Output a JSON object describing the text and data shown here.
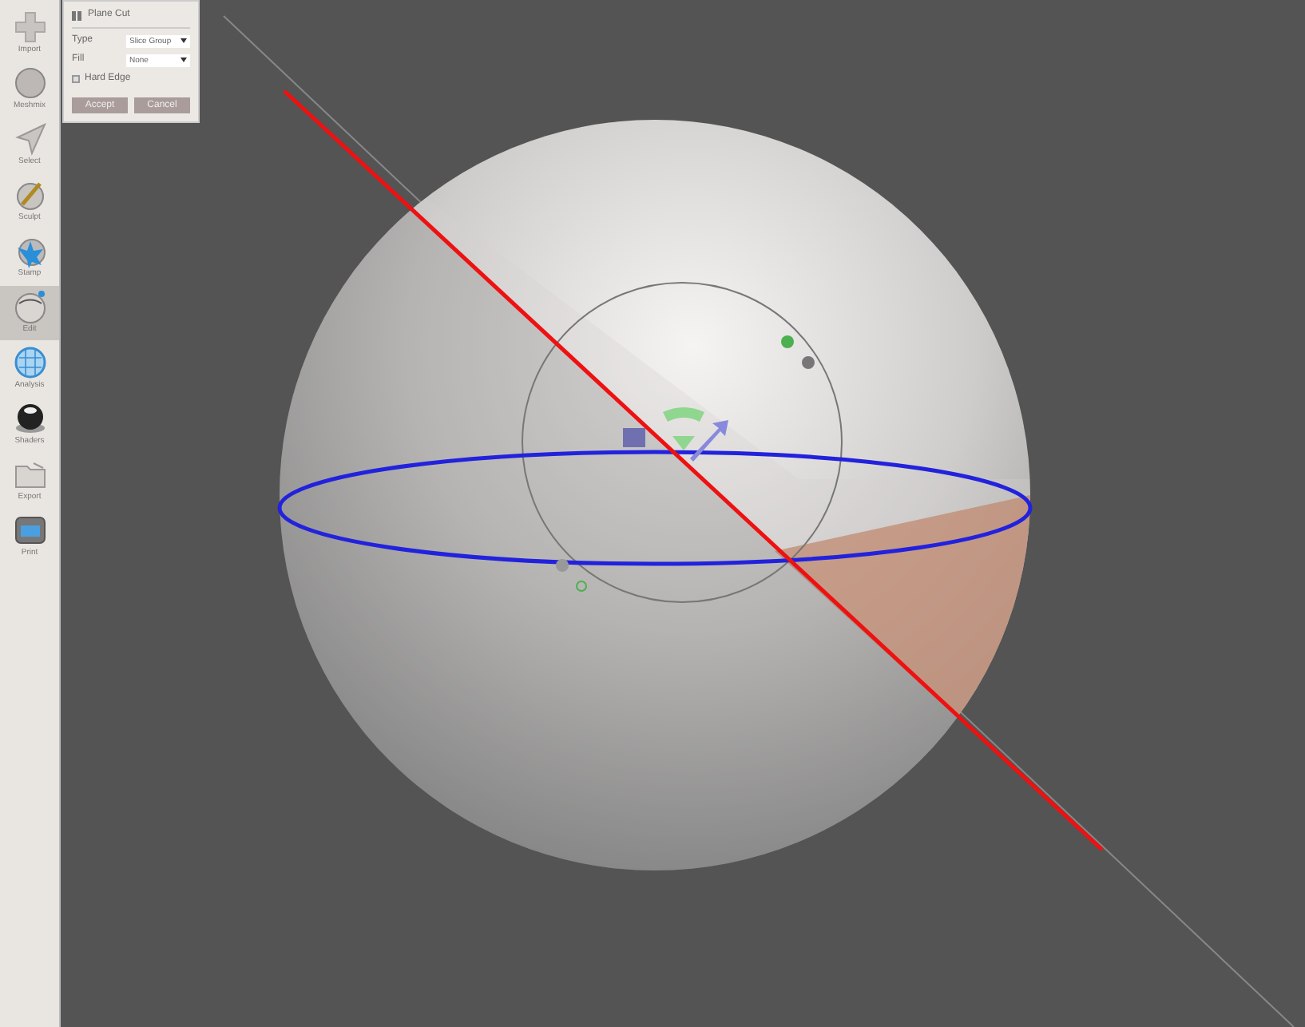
{
  "sidebar": {
    "items": [
      {
        "label": "Import",
        "kind": "plus",
        "selected": false
      },
      {
        "label": "Meshmix",
        "kind": "ball",
        "selected": false
      },
      {
        "label": "Select",
        "kind": "arrow",
        "selected": false
      },
      {
        "label": "Sculpt",
        "kind": "brush",
        "selected": false
      },
      {
        "label": "Stamp",
        "kind": "stamp",
        "selected": false
      },
      {
        "label": "Edit",
        "kind": "edit",
        "selected": true
      },
      {
        "label": "Analysis",
        "kind": "net",
        "selected": false
      },
      {
        "label": "Shaders",
        "kind": "shader",
        "selected": false
      },
      {
        "label": "Export",
        "kind": "export",
        "selected": false
      },
      {
        "label": "Print",
        "kind": "print",
        "selected": false
      }
    ]
  },
  "panel": {
    "title": "Plane Cut",
    "fields": [
      {
        "label": "Type",
        "value": "Slice Group"
      },
      {
        "label": "Fill",
        "value": "None"
      }
    ],
    "hard_edge": {
      "label": "Hard Edge",
      "checked": false
    },
    "buttons": [
      "Accept",
      "Cancel"
    ]
  }
}
